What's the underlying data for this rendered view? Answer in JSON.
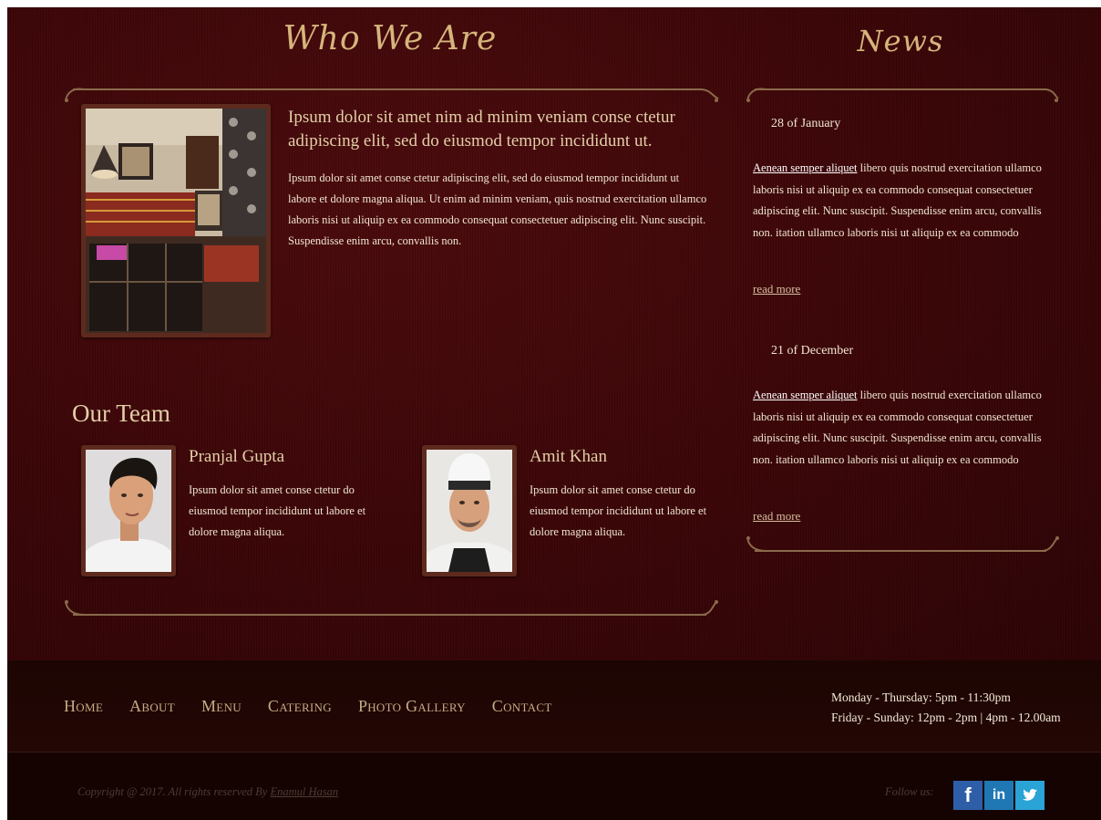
{
  "about": {
    "title": "Who We Are",
    "lead": "Ipsum dolor sit amet nim ad minim veniam conse ctetur adipiscing elit, sed do eiusmod tempor incididunt ut.",
    "body": "Ipsum dolor sit amet conse ctetur adipiscing elit, sed do eiusmod tempor incididunt ut labore et dolore magna aliqua. Ut enim ad minim veniam, quis nostrud exercitation ullamco laboris nisi ut aliquip ex ea commodo consequat consectetuer adipiscing elit. Nunc suscipit. Suspendisse enim arcu, convallis non."
  },
  "team": {
    "title": "Our Team",
    "members": [
      {
        "name": "Pranjal Gupta",
        "bio": "Ipsum dolor sit amet conse ctetur do eiusmod tempor incididunt ut labore et dolore magna aliqua."
      },
      {
        "name": "Amit Khan",
        "bio": "Ipsum dolor sit amet conse ctetur do eiusmod tempor incididunt ut labore et dolore magna aliqua."
      }
    ]
  },
  "news": {
    "title": "News",
    "items": [
      {
        "date": "28 of January",
        "link": "Aenean semper aliquet",
        "text": " libero quis nostrud exercitation ullamco laboris nisi ut aliquip ex ea commodo consequat consectetuer adipiscing elit. Nunc suscipit. Suspendisse enim arcu, convallis non. itation ullamco laboris nisi ut aliquip ex ea commodo",
        "read_more": "read more"
      },
      {
        "date": "21 of December",
        "link": "Aenean semper aliquet",
        "text": " libero quis nostrud exercitation ullamco laboris nisi ut aliquip ex ea commodo consequat consectetuer adipiscing elit. Nunc suscipit. Suspendisse enim arcu, convallis non. itation ullamco laboris nisi ut aliquip ex ea commodo",
        "read_more": "read more"
      }
    ]
  },
  "nav": {
    "items": [
      "Home",
      "About",
      "Menu",
      "Catering",
      "Photo Gallery",
      "Contact"
    ]
  },
  "hours": {
    "weekdays": "Monday - Thursday: 5pm - 11:30pm",
    "weekend": "Friday - Sunday: 12pm - 2pm | 4pm - 12.00am"
  },
  "footer": {
    "copyright_prefix": "Copyright @ 2017. All rights reserved By ",
    "author": "Enamul Hasan",
    "follow_label": "Follow us:",
    "social": [
      {
        "icon": "facebook-icon",
        "glyph": "f",
        "color": "#2f5ea8"
      },
      {
        "icon": "linkedin-icon",
        "glyph": "in",
        "color": "#1f77b4"
      },
      {
        "icon": "twitter-icon",
        "glyph": "t",
        "color": "#2aa3d6"
      }
    ]
  },
  "colors": {
    "background": "#3a0507",
    "heading_gold": "#d6b57c",
    "footer_bg": "#1c0503",
    "bottom_bg": "#150302"
  }
}
